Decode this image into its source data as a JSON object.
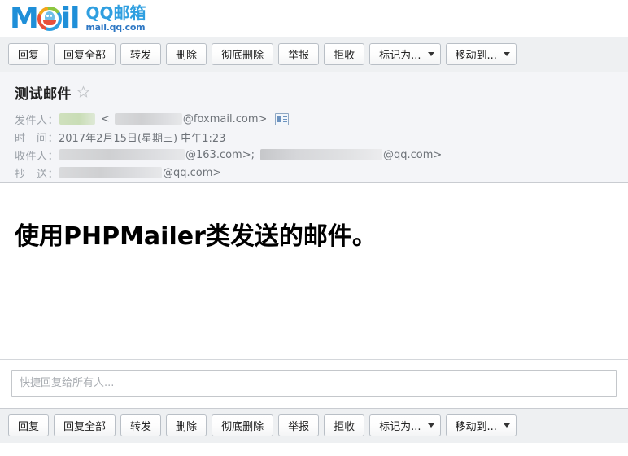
{
  "logo": {
    "brand_mail_m": "M",
    "brand_mail_il": "il",
    "brand_cn": "QQ邮箱",
    "brand_url": "mail.qq.com",
    "penguin_icon": "qq-penguin-icon",
    "accent_blue": "#1f8fd8",
    "accent_red": "#e8503a",
    "accent_green": "#8cc63f",
    "accent_orange": "#f3a51a"
  },
  "toolbar": {
    "buttons": [
      {
        "label": "回复",
        "name": "reply-button",
        "caret": false
      },
      {
        "label": "回复全部",
        "name": "reply-all-button",
        "caret": false
      },
      {
        "label": "转发",
        "name": "forward-button",
        "caret": false
      },
      {
        "label": "删除",
        "name": "delete-button",
        "caret": false
      },
      {
        "label": "彻底删除",
        "name": "delete-forever-button",
        "caret": false
      },
      {
        "label": "举报",
        "name": "report-button",
        "caret": false
      },
      {
        "label": "拒收",
        "name": "block-sender-button",
        "caret": false
      },
      {
        "label": "标记为...",
        "name": "mark-as-button",
        "caret": true
      },
      {
        "label": "移动到...",
        "name": "move-to-button",
        "caret": true
      }
    ]
  },
  "mail": {
    "subject": "测试邮件",
    "star_icon": "star-outline-icon",
    "starred": false,
    "contact_card_icon": "contact-card-icon",
    "fields": {
      "from_label": "发件人：",
      "from_open_bracket": "<",
      "from_domain": "@foxmail.com>",
      "date_label": "时　间：",
      "date_value": "2017年2月15日(星期三) 中午1:23",
      "to_label": "收件人：",
      "to_domain_1": "@163.com>;",
      "to_domain_2": "@qq.com>",
      "cc_label": "抄　送：",
      "cc_domain": "@qq.com>"
    },
    "body_text": "使用PHPMailer类发送的邮件。"
  },
  "quick_reply": {
    "placeholder": "快捷回复给所有人...",
    "value": ""
  }
}
